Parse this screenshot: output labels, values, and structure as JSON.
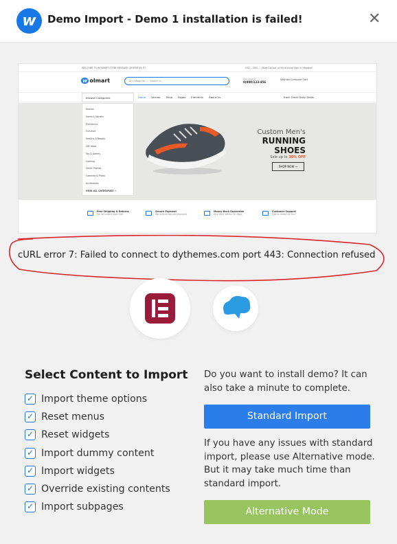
{
  "header": {
    "logo_letter": "w",
    "title": "Demo Import - Demo 1 installation is failed!",
    "close_glyph": "✕"
  },
  "preview": {
    "topbar_left": "WELCOME TO WOLMART STORE MESSAGE OR REMOVE IT!",
    "topbar_right": "USD ⌄   ENG ⌄   |   Blog   Contact us   My Account   Sign in / Register",
    "logo_letter": "w",
    "logo_text": "olmart",
    "search_category": "All Categories ⌄",
    "search_placeholder": "Search in...",
    "call_label": "Live Chat or:",
    "call_number": "0(800)123-456",
    "mini_icons": "Wishlist   Compare   Cart",
    "browse_label": "Browse Categories",
    "nav_links": [
      "Home",
      "Vendor",
      "Shop",
      "Pages",
      "Elements",
      "About Us"
    ],
    "nav_right": "Track Order    Daily Deals",
    "categories": [
      "Fashion",
      "Home & Garden",
      "Electronics",
      "Furniture",
      "Healthy & Beauty",
      "Gift Ideas",
      "Toy & Games",
      "Cooking",
      "Smart Phones",
      "Cameras & Photo",
      "Accessories",
      "VIEW ALL CATEGORIES →"
    ],
    "hero_line1": "Custom Men's",
    "hero_line2": "RUNNING SHOES",
    "hero_line3_prefix": "Sale up to",
    "hero_line3_value": "30% OFF",
    "shop_now": "SHOP NOW →",
    "features": [
      {
        "title": "Free Shipping & Returns",
        "sub": "For all orders over $99"
      },
      {
        "title": "Secure Payment",
        "sub": "We ensure secure payment"
      },
      {
        "title": "Money Back Guarantee",
        "sub": "Any back within 30 days"
      },
      {
        "title": "Customer Support",
        "sub": "Call or email us 24/7"
      }
    ]
  },
  "error_message": "cURL error 7: Failed to connect to dythemes.com port 443: Connection refused",
  "plugins": {
    "elementor_icon": "elementor-icon",
    "cloud_icon": "cloud-bird-icon",
    "elementor_color": "#9b1c3a",
    "cloud_color": "#2a9be0"
  },
  "content": {
    "title": "Select Content to Import",
    "options": [
      {
        "label": "Import theme options",
        "checked": true
      },
      {
        "label": "Reset menus",
        "checked": true
      },
      {
        "label": "Reset widgets",
        "checked": true
      },
      {
        "label": "Import dummy content",
        "checked": true
      },
      {
        "label": "Import widgets",
        "checked": true
      },
      {
        "label": "Override existing contents",
        "checked": true
      },
      {
        "label": "Import subpages",
        "checked": true
      }
    ]
  },
  "install": {
    "prompt": "Do you want to install demo? It can also take a minute to complete.",
    "standard_button": "Standard Import",
    "alt_note": "If you have any issues with standard import, please use Alternative mode. But it may take much time than standard import.",
    "alt_button": "Alternative Mode"
  },
  "colors": {
    "accent": "#1778e6",
    "standard_button": "#2b7de9",
    "alternative_button": "#97c45e",
    "error_ellipse": "#d9252a"
  }
}
